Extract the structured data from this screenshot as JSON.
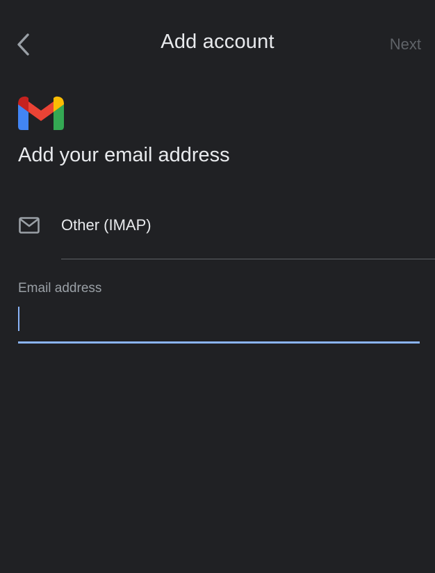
{
  "header": {
    "back_icon": "chevron-left-icon",
    "title": "Add account",
    "next_label": "Next",
    "next_enabled": false
  },
  "logo": {
    "icon": "gmail-logo",
    "colors": {
      "blue": "#4285F4",
      "red": "#EA4335",
      "dark_red": "#C5221F",
      "yellow": "#FBBC04",
      "green": "#34A853"
    }
  },
  "main": {
    "heading": "Add your email address",
    "provider": {
      "icon": "mail-icon",
      "label": "Other (IMAP)"
    },
    "email_field": {
      "label": "Email address",
      "value": "",
      "placeholder": "",
      "focused": true
    }
  },
  "theme": {
    "background": "#202124",
    "text": "#e8eaed",
    "muted_text": "#9aa0a6",
    "disabled_text": "#5f6368",
    "accent": "#8ab4f8"
  }
}
